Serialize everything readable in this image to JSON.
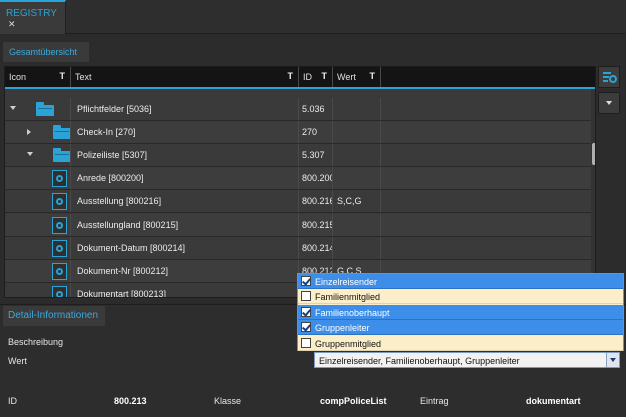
{
  "tabs": {
    "registry_label": "REGISTRY",
    "close_glyph": "✕"
  },
  "subtab": {
    "label": "Gesamtübersicht"
  },
  "grid": {
    "columns": [
      {
        "label": "Icon",
        "filter": "T"
      },
      {
        "label": "Text",
        "filter": "T"
      },
      {
        "label": "ID",
        "filter": "T"
      },
      {
        "label": "Wert",
        "filter": "T"
      }
    ],
    "rows": [
      {
        "text": "Pflichtfelder [5036]",
        "id": "5.036",
        "wert": "",
        "kind": "folder",
        "expander": "down"
      },
      {
        "text": "Check-In [270]",
        "id": "270",
        "wert": "",
        "kind": "folder",
        "expander": "right"
      },
      {
        "text": "Polizeiliste [5307]",
        "id": "5.307",
        "wert": "",
        "kind": "folder",
        "expander": "down"
      },
      {
        "text": "Anrede [800200]",
        "id": "800.200",
        "wert": "",
        "kind": "doc"
      },
      {
        "text": "Ausstellung [800216]",
        "id": "800.216",
        "wert": "S,C,G",
        "kind": "doc"
      },
      {
        "text": "Ausstellungland [800215]",
        "id": "800.215",
        "wert": "",
        "kind": "doc"
      },
      {
        "text": "Dokument-Datum [800214]",
        "id": "800.214",
        "wert": "",
        "kind": "doc"
      },
      {
        "text": "Dokument-Nr [800212]",
        "id": "800.212",
        "wert": "G,C,S",
        "kind": "doc"
      },
      {
        "text": "Dokumentart [800213]",
        "id": "8",
        "wert": "",
        "kind": "doc"
      }
    ]
  },
  "side": {
    "tool_icon": "settings-tool-icon",
    "chevron_icon": "chevron-down-icon"
  },
  "detail": {
    "tab_label": "Detail-Informationen",
    "beschreibung_label": "Beschreibung",
    "wert_label": "Wert",
    "wert_value": "Einzelreisender, Familienoberhaupt, Gruppenleiter"
  },
  "dropdown": {
    "options": [
      {
        "label": "Einzelreisender",
        "checked": true
      },
      {
        "label": "Familienmitglied",
        "checked": false
      },
      {
        "label": "Familienoberhaupt",
        "checked": true
      },
      {
        "label": "Gruppenleiter",
        "checked": true
      },
      {
        "label": "Gruppenmitglied",
        "checked": false
      }
    ]
  },
  "footer": {
    "id_label": "ID",
    "id_value": "800.213",
    "klasse_label": "Klasse",
    "klasse_value": "compPoliceList",
    "eintrag_label": "Eintrag",
    "eintrag_value": "dokumentart"
  },
  "colors": {
    "accent": "#2aa3d6",
    "selection": "#3d8ee8",
    "popup_bg": "#fbeec9"
  }
}
